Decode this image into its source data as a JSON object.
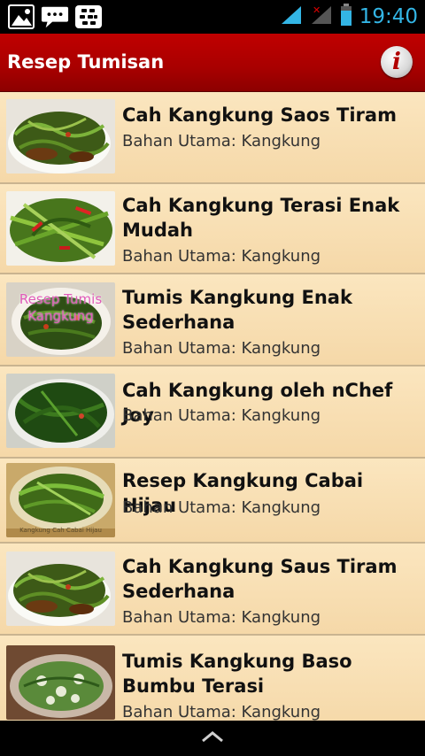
{
  "status_bar": {
    "time": "19:40",
    "icons": [
      "gallery-icon",
      "chat-icon",
      "bbm-icon",
      "wifi-icon",
      "signal-icon",
      "battery-icon"
    ]
  },
  "action_bar": {
    "title": "Resep Tumisan",
    "info_icon": "info-icon"
  },
  "recipes": [
    {
      "title": "Cah Kangkung Saos Tiram",
      "subtitle": "Bahan Utama: Kangkung",
      "watermark": ""
    },
    {
      "title": "Cah Kangkung Terasi Enak Mudah",
      "subtitle": "Bahan Utama: Kangkung",
      "watermark": ""
    },
    {
      "title": "Tumis Kangkung Enak Sederhana",
      "subtitle": "Bahan Utama: Kangkung",
      "watermark": "Resep Tumis Kangkung"
    },
    {
      "title": "Cah Kangkung oleh nChef Joy",
      "subtitle": "Bahan Utama: Kangkung",
      "watermark": ""
    },
    {
      "title": "Resep Kangkung Cabai Hijau",
      "subtitle": "Bahan Utama: Kangkung",
      "watermark": "Kangkung Cah Cabai Hijau"
    },
    {
      "title": "Cah Kangkung Saus Tiram Sederhana",
      "subtitle": "Bahan Utama: Kangkung",
      "watermark": ""
    },
    {
      "title": "Tumis Kangkung Baso Bumbu Terasi",
      "subtitle": "Bahan Utama: Kangkung",
      "watermark": ""
    }
  ],
  "nav_bar": {
    "icon": "chevron-up-icon"
  },
  "colors": {
    "action_bar": "#b00000",
    "list_bg": "#f8dfb3",
    "status_accent": "#33b5e5"
  }
}
